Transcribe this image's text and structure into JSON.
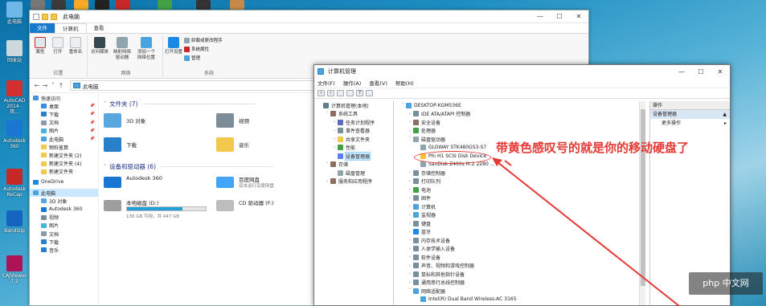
{
  "desktop_icons": [
    {
      "label": "此电脑",
      "color": "#6fb7e8"
    },
    {
      "label": "回收站",
      "color": "#cfd8dc"
    },
    {
      "label": "AutoCAD 2014 - 简...",
      "color": "#d32f2f"
    },
    {
      "label": "Autodesk 360",
      "color": "#1976d2"
    },
    {
      "label": "Autodesk ReCap",
      "color": "#c62828"
    },
    {
      "label": "Bandizip",
      "color": "#1565c0"
    },
    {
      "label": "CAJViewer 7.2",
      "color": "#ad1457"
    }
  ],
  "explorer": {
    "title": "此电脑",
    "ribbon_tabs": [
      "文件",
      "计算机",
      "查看"
    ],
    "ribbon": {
      "location_group": "位置",
      "network_group": "网络",
      "system_group": "系统",
      "buttons": [
        "属性",
        "打开",
        "重命名",
        "访问媒体",
        "映射网络驱动器",
        "添加一个网络位置",
        "打开设置"
      ],
      "small_buttons": [
        "卸载或更改程序",
        "系统属性",
        "管理"
      ]
    },
    "address": "此电脑",
    "nav": [
      {
        "label": "快速访问",
        "pin": false,
        "color": "#4a90d9",
        "selected": false
      },
      {
        "label": "桌面",
        "pin": true,
        "color": "#3a8de0",
        "selected": false
      },
      {
        "label": "下载",
        "pin": true,
        "color": "#2a7fc9",
        "selected": false
      },
      {
        "label": "文档",
        "pin": true,
        "color": "#8a9aa8",
        "selected": false
      },
      {
        "label": "图片",
        "pin": true,
        "color": "#4ab3e0",
        "selected": false
      },
      {
        "label": "此电脑",
        "pin": true,
        "color": "#4aa3df",
        "selected": false
      },
      {
        "label": "物料鉴算",
        "pin": false,
        "color": "#f2c94c",
        "selected": false
      },
      {
        "label": "新建文件夹 (2)",
        "pin": false,
        "color": "#f2c94c",
        "selected": false
      },
      {
        "label": "新建文件夹 (4)",
        "pin": false,
        "color": "#f2c94c",
        "selected": false
      },
      {
        "label": "新建文件夹",
        "pin": false,
        "color": "#f2c94c",
        "selected": false
      },
      {
        "label": "OneDrive",
        "pin": false,
        "color": "#1e88e5",
        "selected": false
      },
      {
        "label": "此电脑",
        "pin": false,
        "color": "#4aa3df",
        "selected": true
      },
      {
        "label": "3D 对象",
        "pin": false,
        "color": "#5aa7e0",
        "selected": false
      },
      {
        "label": "Autodesk 360",
        "pin": false,
        "color": "#1976d2",
        "selected": false
      },
      {
        "label": "视频",
        "pin": false,
        "color": "#7d8c99",
        "selected": false
      },
      {
        "label": "图片",
        "pin": false,
        "color": "#4ab3e0",
        "selected": false
      },
      {
        "label": "文档",
        "pin": false,
        "color": "#8a9aa8",
        "selected": false
      },
      {
        "label": "下载",
        "pin": false,
        "color": "#2a7fc9",
        "selected": false
      },
      {
        "label": "音乐",
        "pin": false,
        "color": "#2a7fc9",
        "selected": false
      }
    ],
    "folders_header": "文件夹 (7)",
    "folders": [
      {
        "label": "3D 对象",
        "color": "#5aa7e0"
      },
      {
        "label": "视频",
        "color": "#7d8c99"
      },
      {
        "label": "下载",
        "color": "#2a7fc9"
      },
      {
        "label": "音乐",
        "color": "#f2c94c"
      }
    ],
    "devices_header": "设备和驱动器 (6)",
    "devices": [
      {
        "label": "Autodesk 360",
        "color": "#1976d2",
        "has_bar": false,
        "fill": 0,
        "sub": ""
      },
      {
        "label": "百度网盘\n双击运行百度网盘",
        "color": "#42a5f5",
        "has_bar": false,
        "fill": 0,
        "sub": ""
      },
      {
        "label": "本地磁盘 (D:)",
        "color": "#9e9e9e",
        "has_bar": true,
        "fill": 0.7,
        "sub": "136 GB 可用，共 447 GB"
      },
      {
        "label": "CD 驱动器 (F:)",
        "color": "#bdbdbd",
        "has_bar": false,
        "fill": 0,
        "sub": ""
      }
    ]
  },
  "cm": {
    "title": "计算机管理",
    "menu": [
      "文件(F)",
      "操作(A)",
      "查看(V)",
      "帮助(H)"
    ],
    "tree": [
      {
        "label": "计算机管理(本地)",
        "indent": 0,
        "twisty": "",
        "color": "#607d8b",
        "selected": false
      },
      {
        "label": "系统工具",
        "indent": 1,
        "twisty": "v",
        "color": "#8d6e63",
        "selected": false
      },
      {
        "label": "任务计划程序",
        "indent": 2,
        "twisty": ">",
        "color": "#5c6bc0",
        "selected": false
      },
      {
        "label": "事件查看器",
        "indent": 2,
        "twisty": ">",
        "color": "#78909c",
        "selected": false
      },
      {
        "label": "共享文件夹",
        "indent": 2,
        "twisty": ">",
        "color": "#f2c94c",
        "selected": false
      },
      {
        "label": "性能",
        "indent": 2,
        "twisty": ">",
        "color": "#43a047",
        "selected": false
      },
      {
        "label": "设备管理器",
        "indent": 2,
        "twisty": "",
        "color": "#5c7cfa",
        "selected": true
      },
      {
        "label": "存储",
        "indent": 1,
        "twisty": "v",
        "color": "#8d6e63",
        "selected": false
      },
      {
        "label": "磁盘管理",
        "indent": 2,
        "twisty": "",
        "color": "#90a4ae",
        "selected": false
      },
      {
        "label": "服务和应用程序",
        "indent": 1,
        "twisty": ">",
        "color": "#8d6e63",
        "selected": false
      }
    ],
    "devices": [
      {
        "label": "DESKTOP-KGM536E",
        "indent": 0,
        "twisty": "v",
        "color": "#4aa3df"
      },
      {
        "label": "IDE ATA/ATAPI 控制器",
        "indent": 1,
        "twisty": ">",
        "color": "#78909c"
      },
      {
        "label": "安全设备",
        "indent": 1,
        "twisty": ">",
        "color": "#8d6e63"
      },
      {
        "label": "处理器",
        "indent": 1,
        "twisty": ">",
        "color": "#43a047"
      },
      {
        "label": "磁盘驱动器",
        "indent": 1,
        "twisty": "v",
        "color": "#90a4ae"
      },
      {
        "label": "GLOWAY STK480GS3-S7",
        "indent": 2,
        "twisty": "",
        "color": "#90a4ae"
      },
      {
        "label": "Phi H1 SCSI Disk Device",
        "indent": 2,
        "twisty": "",
        "color": "#fbc02d"
      },
      {
        "label": "SanDisk Z400s M.2 2280 ...",
        "indent": 2,
        "twisty": "",
        "color": "#90a4ae"
      },
      {
        "label": "存储控制器",
        "indent": 1,
        "twisty": ">",
        "color": "#78909c"
      },
      {
        "label": "打印队列",
        "indent": 1,
        "twisty": ">",
        "color": "#78909c"
      },
      {
        "label": "电池",
        "indent": 1,
        "twisty": ">",
        "color": "#43a047"
      },
      {
        "label": "固件",
        "indent": 1,
        "twisty": ">",
        "color": "#78909c"
      },
      {
        "label": "计算机",
        "indent": 1,
        "twisty": ">",
        "color": "#4aa3df"
      },
      {
        "label": "监视器",
        "indent": 1,
        "twisty": ">",
        "color": "#4aa3df"
      },
      {
        "label": "键盘",
        "indent": 1,
        "twisty": ">",
        "color": "#78909c"
      },
      {
        "label": "蓝牙",
        "indent": 1,
        "twisty": ">",
        "color": "#1e88e5"
      },
      {
        "label": "内存技术设备",
        "indent": 1,
        "twisty": ">",
        "color": "#78909c"
      },
      {
        "label": "人体学输入设备",
        "indent": 1,
        "twisty": ">",
        "color": "#78909c"
      },
      {
        "label": "软件设备",
        "indent": 1,
        "twisty": ">",
        "color": "#78909c"
      },
      {
        "label": "声音、视频和游戏控制器",
        "indent": 1,
        "twisty": ">",
        "color": "#78909c"
      },
      {
        "label": "鼠标和其他指针设备",
        "indent": 1,
        "twisty": ">",
        "color": "#78909c"
      },
      {
        "label": "通用串行总线控制器",
        "indent": 1,
        "twisty": ">",
        "color": "#78909c"
      },
      {
        "label": "网络适配器",
        "indent": 1,
        "twisty": "v",
        "color": "#4aa3df"
      },
      {
        "label": "Intel(R) Dual Band Wireless-AC 3165",
        "indent": 2,
        "twisty": "",
        "color": "#4aa3df"
      }
    ],
    "actions_header": "操作",
    "actions_selected": "设备管理器",
    "actions_more": "更多操作"
  },
  "annotation": {
    "text": "带黄色感叹号的就是你的移动硬盘了",
    "color": "#e53935"
  },
  "watermark": "php 中文网"
}
